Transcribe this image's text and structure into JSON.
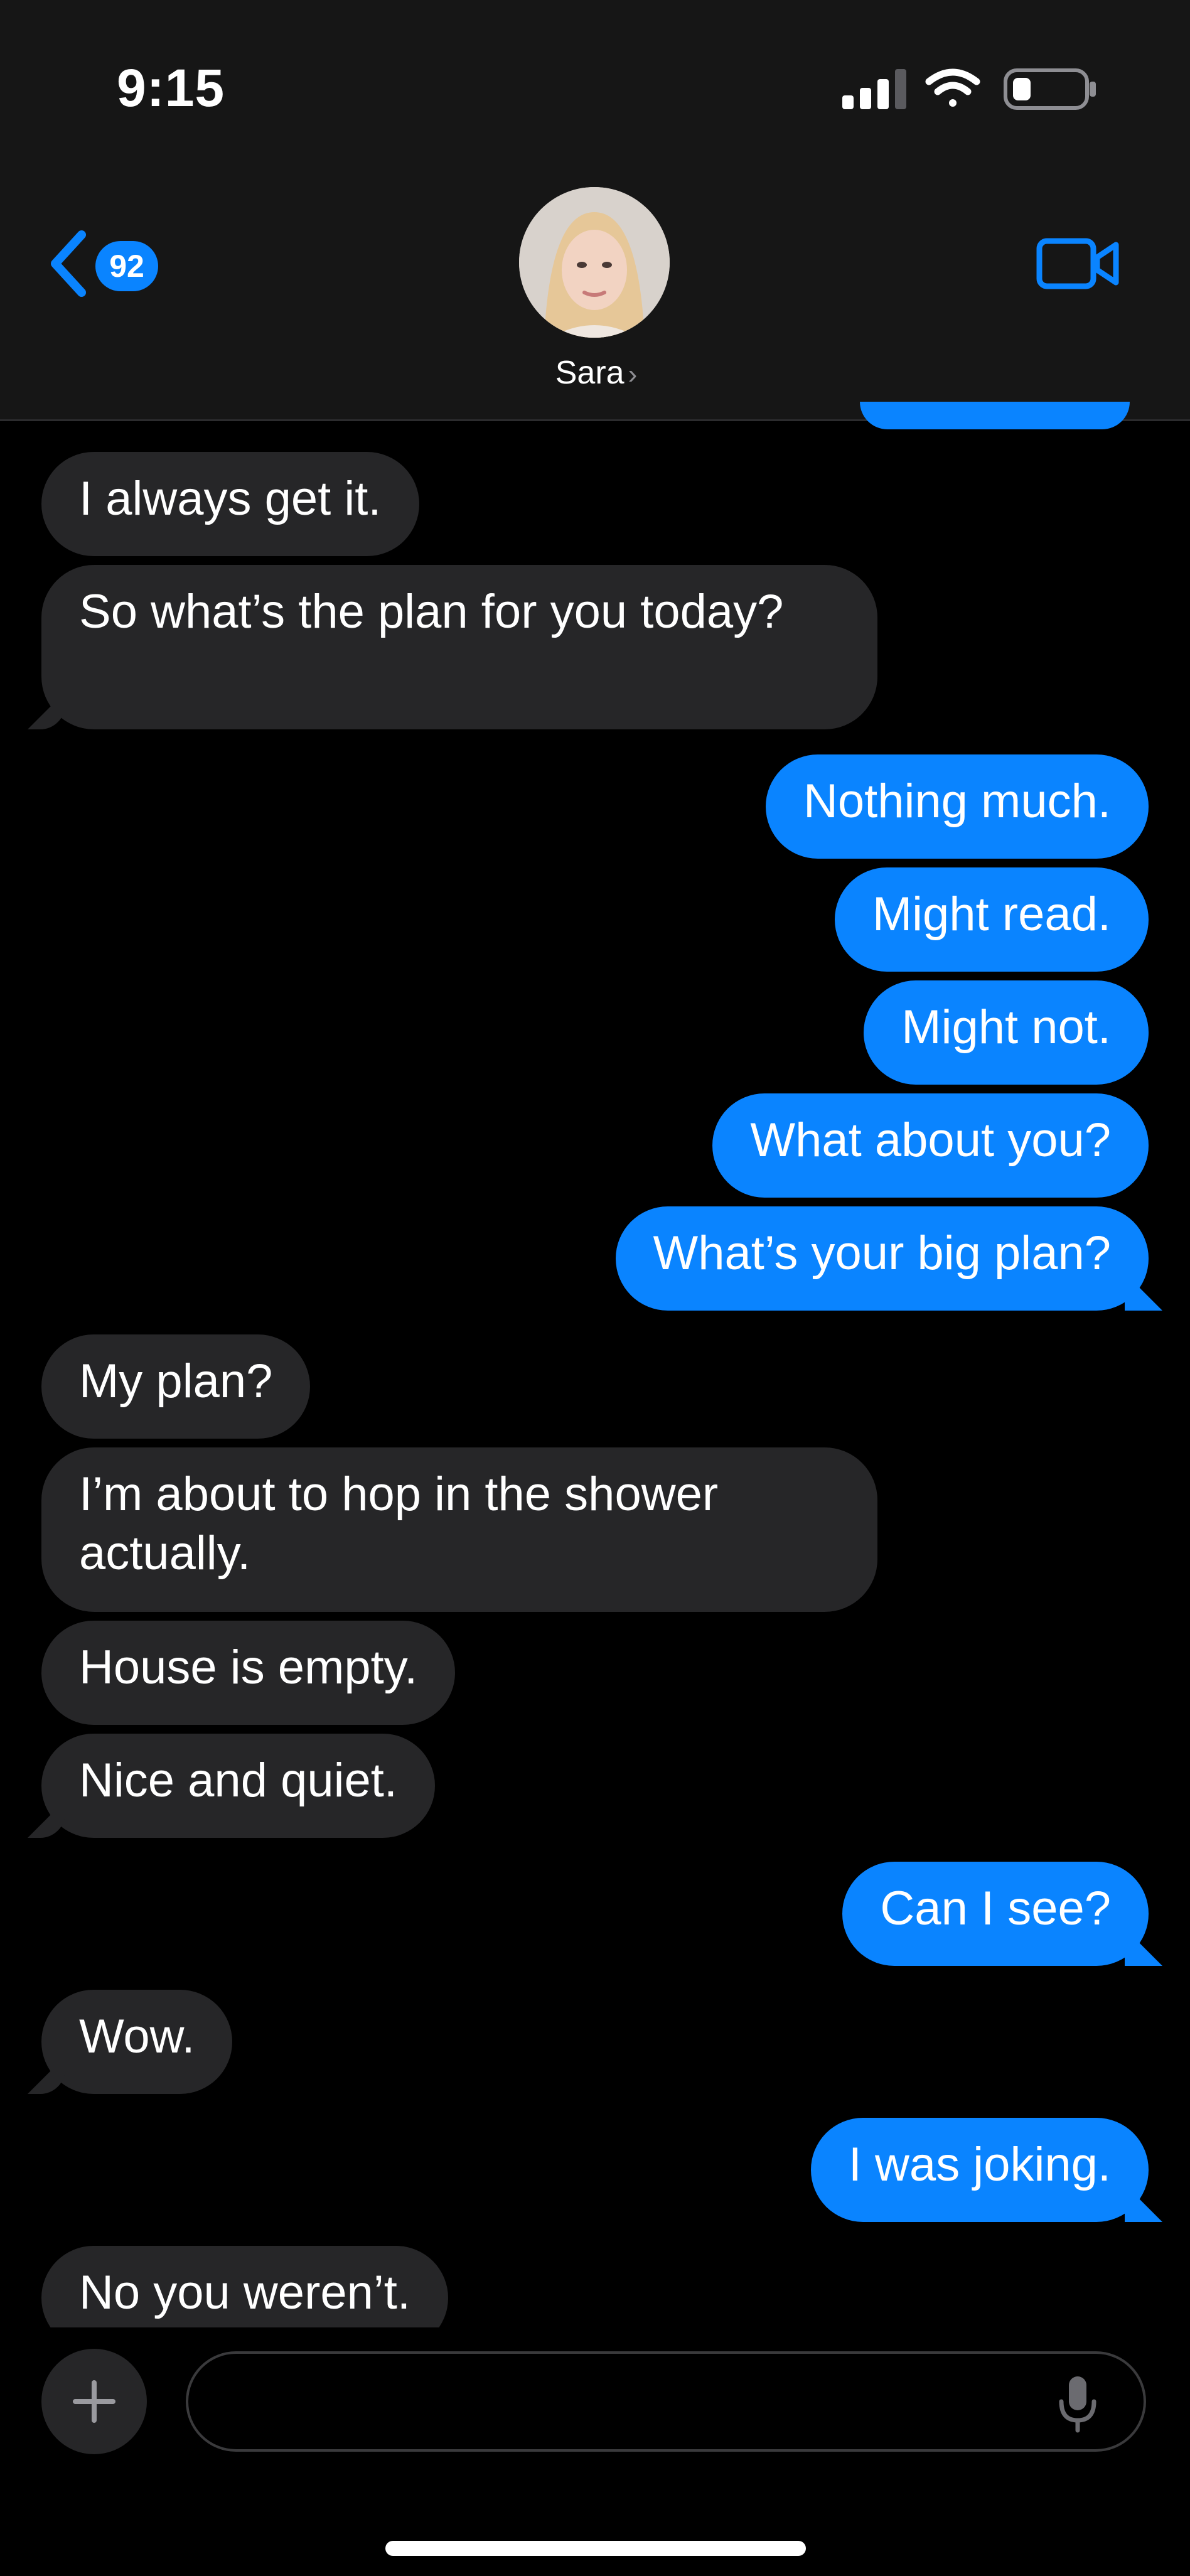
{
  "status": {
    "time": "9:15"
  },
  "header": {
    "back_badge": "92",
    "contact_name": "Sara",
    "contact_chevron": "›"
  },
  "messages": [
    {
      "from": "contact",
      "text": "I always get it."
    },
    {
      "from": "contact",
      "text": "So what’s the plan for you today?"
    },
    {
      "from": "me",
      "text": "Nothing much."
    },
    {
      "from": "me",
      "text": "Might read."
    },
    {
      "from": "me",
      "text": "Might not."
    },
    {
      "from": "me",
      "text": "What about you?"
    },
    {
      "from": "me",
      "text": "What’s your big plan?"
    },
    {
      "from": "contact",
      "text": "My plan?"
    },
    {
      "from": "contact",
      "text": "I’m about to hop in the shower actually."
    },
    {
      "from": "contact",
      "text": "House is empty."
    },
    {
      "from": "contact",
      "text": "Nice and quiet."
    },
    {
      "from": "me",
      "text": "Can I see?"
    },
    {
      "from": "contact",
      "text": "Wow."
    },
    {
      "from": "me",
      "text": "I was joking."
    },
    {
      "from": "contact",
      "text": "No you weren’t."
    }
  ],
  "composer": {
    "placeholder": ""
  },
  "colors": {
    "accent": "#0a84ff",
    "incoming": "#262628",
    "background": "#000000"
  },
  "icons": [
    "signal-icon",
    "wifi-icon",
    "battery-icon",
    "back-chevron-icon",
    "video-call-icon",
    "plus-icon",
    "mic-icon"
  ]
}
